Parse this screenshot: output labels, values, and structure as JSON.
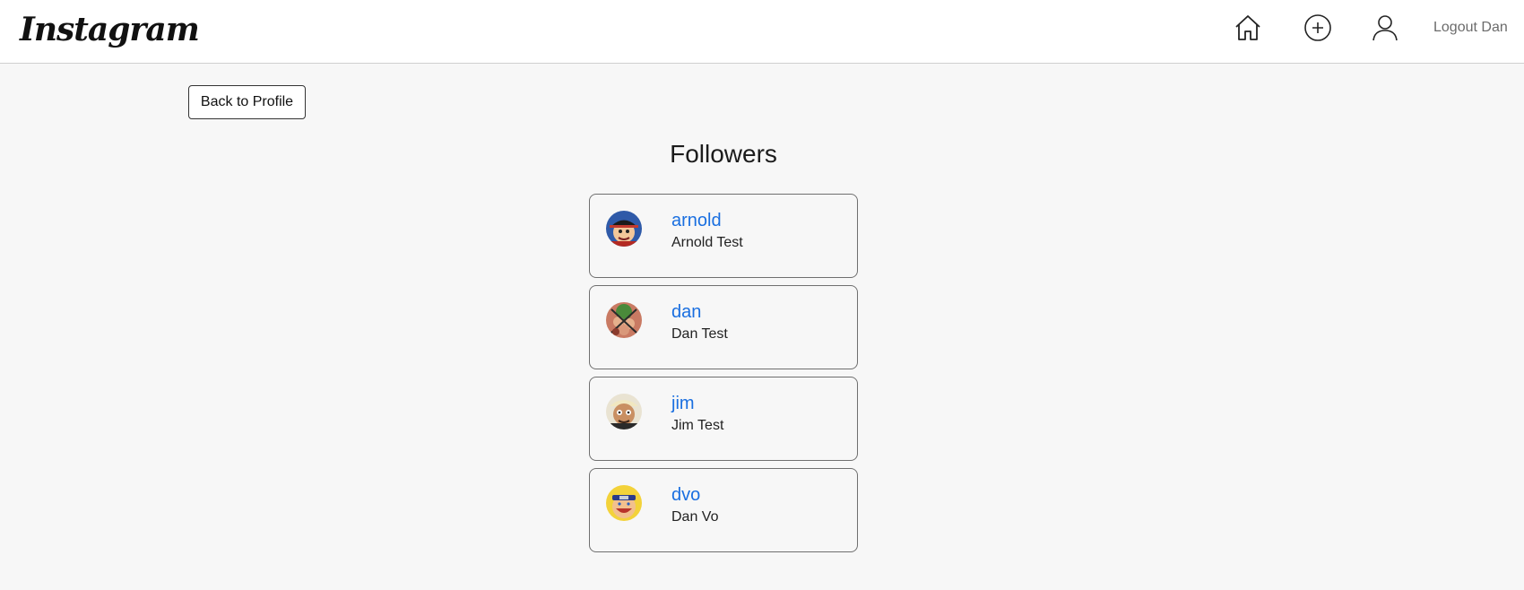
{
  "navbar": {
    "logo_text": "Instagram",
    "icons": [
      "home-icon",
      "add-post-icon",
      "profile-icon"
    ],
    "logout_label": "Logout Dan"
  },
  "back_button_label": "Back to Profile",
  "page_title": "Followers",
  "followers": [
    {
      "username": "arnold",
      "full_name": "Arnold Test",
      "avatar_icon": "avatar-arnold"
    },
    {
      "username": "dan",
      "full_name": "Dan Test",
      "avatar_icon": "avatar-dan"
    },
    {
      "username": "jim",
      "full_name": "Jim Test",
      "avatar_icon": "avatar-jim"
    },
    {
      "username": "dvo",
      "full_name": "Dan Vo",
      "avatar_icon": "avatar-dvo"
    }
  ],
  "colors": {
    "link": "#1a6fe0",
    "background": "#f7f7f7",
    "navbar": "#ffffff",
    "card_border": "#6f6f6f"
  }
}
